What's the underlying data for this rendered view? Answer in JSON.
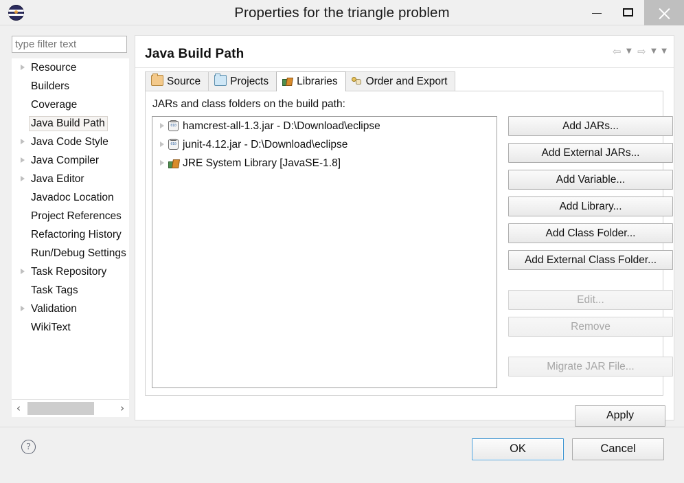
{
  "window": {
    "title": "Properties for the triangle problem",
    "icon": "eclipse-logo",
    "minimize_label": "",
    "maximize_label": "",
    "close_label": ""
  },
  "filter": {
    "placeholder": "type filter text",
    "value": ""
  },
  "sidebar": {
    "items": [
      {
        "label": "Resource",
        "expandable": true,
        "selected": false
      },
      {
        "label": "Builders",
        "expandable": false,
        "selected": false
      },
      {
        "label": "Coverage",
        "expandable": false,
        "selected": false
      },
      {
        "label": "Java Build Path",
        "expandable": false,
        "selected": true
      },
      {
        "label": "Java Code Style",
        "expandable": true,
        "selected": false
      },
      {
        "label": "Java Compiler",
        "expandable": true,
        "selected": false
      },
      {
        "label": "Java Editor",
        "expandable": true,
        "selected": false
      },
      {
        "label": "Javadoc Location",
        "expandable": false,
        "selected": false
      },
      {
        "label": "Project References",
        "expandable": false,
        "selected": false
      },
      {
        "label": "Refactoring History",
        "expandable": false,
        "selected": false
      },
      {
        "label": "Run/Debug Settings",
        "expandable": false,
        "selected": false
      },
      {
        "label": "Task Repository",
        "expandable": true,
        "selected": false
      },
      {
        "label": "Task Tags",
        "expandable": false,
        "selected": false
      },
      {
        "label": "Validation",
        "expandable": true,
        "selected": false
      },
      {
        "label": "WikiText",
        "expandable": false,
        "selected": false
      }
    ],
    "scroll_left": "‹",
    "scroll_right": "›"
  },
  "page": {
    "title": "Java Build Path",
    "nav": {
      "back": "⇦",
      "back_caret": "▼",
      "forward": "⇨",
      "forward_caret": "▼",
      "menu_caret": "▼"
    }
  },
  "tabs": [
    {
      "label": "Source",
      "icon": "package-icon",
      "active": false
    },
    {
      "label": "Projects",
      "icon": "folder-icon",
      "active": false
    },
    {
      "label": "Libraries",
      "icon": "library-icon",
      "active": true
    },
    {
      "label": "Order and Export",
      "icon": "order-export-icon",
      "active": false
    }
  ],
  "libraries_tab": {
    "list_label": "JARs and class folders on the build path:",
    "entries": [
      {
        "label": "hamcrest-all-1.3.jar - D:\\Download\\eclipse",
        "icon": "jar-icon",
        "expandable": true
      },
      {
        "label": "junit-4.12.jar - D:\\Download\\eclipse",
        "icon": "jar-icon",
        "expandable": true
      },
      {
        "label": "JRE System Library [JavaSE-1.8]",
        "icon": "jre-library-icon",
        "expandable": true
      }
    ],
    "buttons": [
      {
        "label": "Add JARs...",
        "enabled": true,
        "gap": false
      },
      {
        "label": "Add External JARs...",
        "enabled": true,
        "gap": false
      },
      {
        "label": "Add Variable...",
        "enabled": true,
        "gap": false
      },
      {
        "label": "Add Library...",
        "enabled": true,
        "gap": false
      },
      {
        "label": "Add Class Folder...",
        "enabled": true,
        "gap": false
      },
      {
        "label": "Add External Class Folder...",
        "enabled": true,
        "gap": false
      },
      {
        "label": "Edit...",
        "enabled": false,
        "gap": true
      },
      {
        "label": "Remove",
        "enabled": false,
        "gap": false
      },
      {
        "label": "Migrate JAR File...",
        "enabled": false,
        "gap": true
      }
    ],
    "apply_label": "Apply"
  },
  "footer": {
    "help_glyph": "?",
    "ok_label": "OK",
    "cancel_label": "Cancel"
  },
  "colors": {
    "dialog_bg": "#f0f0f0",
    "panel_bg": "#ffffff",
    "focus_blue": "#3f96d2",
    "close_btn_bg": "#bfbfbf",
    "selection_bg": "#f6f4f2"
  }
}
